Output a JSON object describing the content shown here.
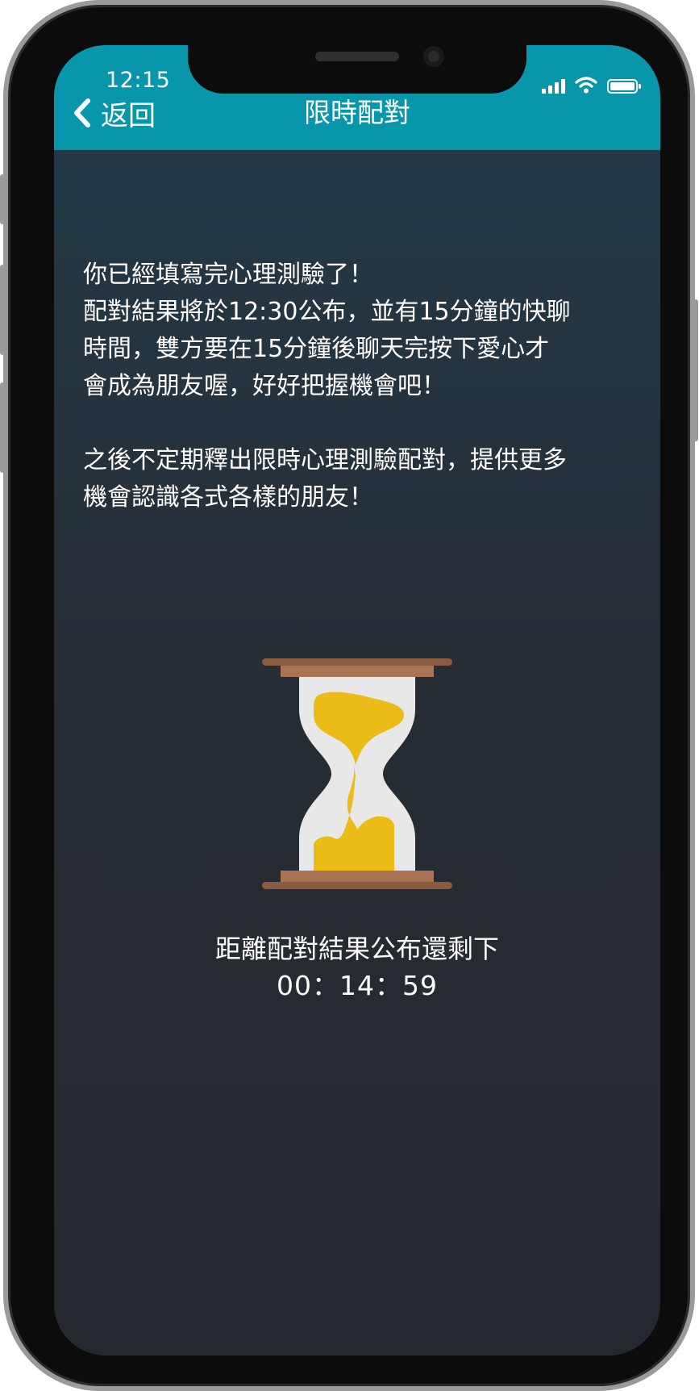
{
  "status_bar": {
    "time": "12:15",
    "signal_icon": "cellular-signal-icon",
    "wifi_icon": "wifi-icon",
    "battery_icon": "battery-icon"
  },
  "header": {
    "back_label": "返回",
    "back_icon": "chevron-left-icon",
    "title": "限時配對",
    "background_color": "#0896ab"
  },
  "message": {
    "paragraph_1": "你已經填寫完心理測驗了！\n配對結果將於12:30公布，並有15分鐘的快聊\n時間，雙方要在15分鐘後聊天完按下愛心才\n會成為朋友喔，好好把握機會吧！",
    "paragraph_2": "之後不定期釋出限時心理測驗配對，提供更多\n機會認識各式各樣的朋友！"
  },
  "countdown": {
    "icon": "hourglass-icon",
    "label": "距離配對結果公布還剩下",
    "time": "00：14：59",
    "sand_color": "#ebbc17",
    "frame_color": "#8b5b40"
  }
}
